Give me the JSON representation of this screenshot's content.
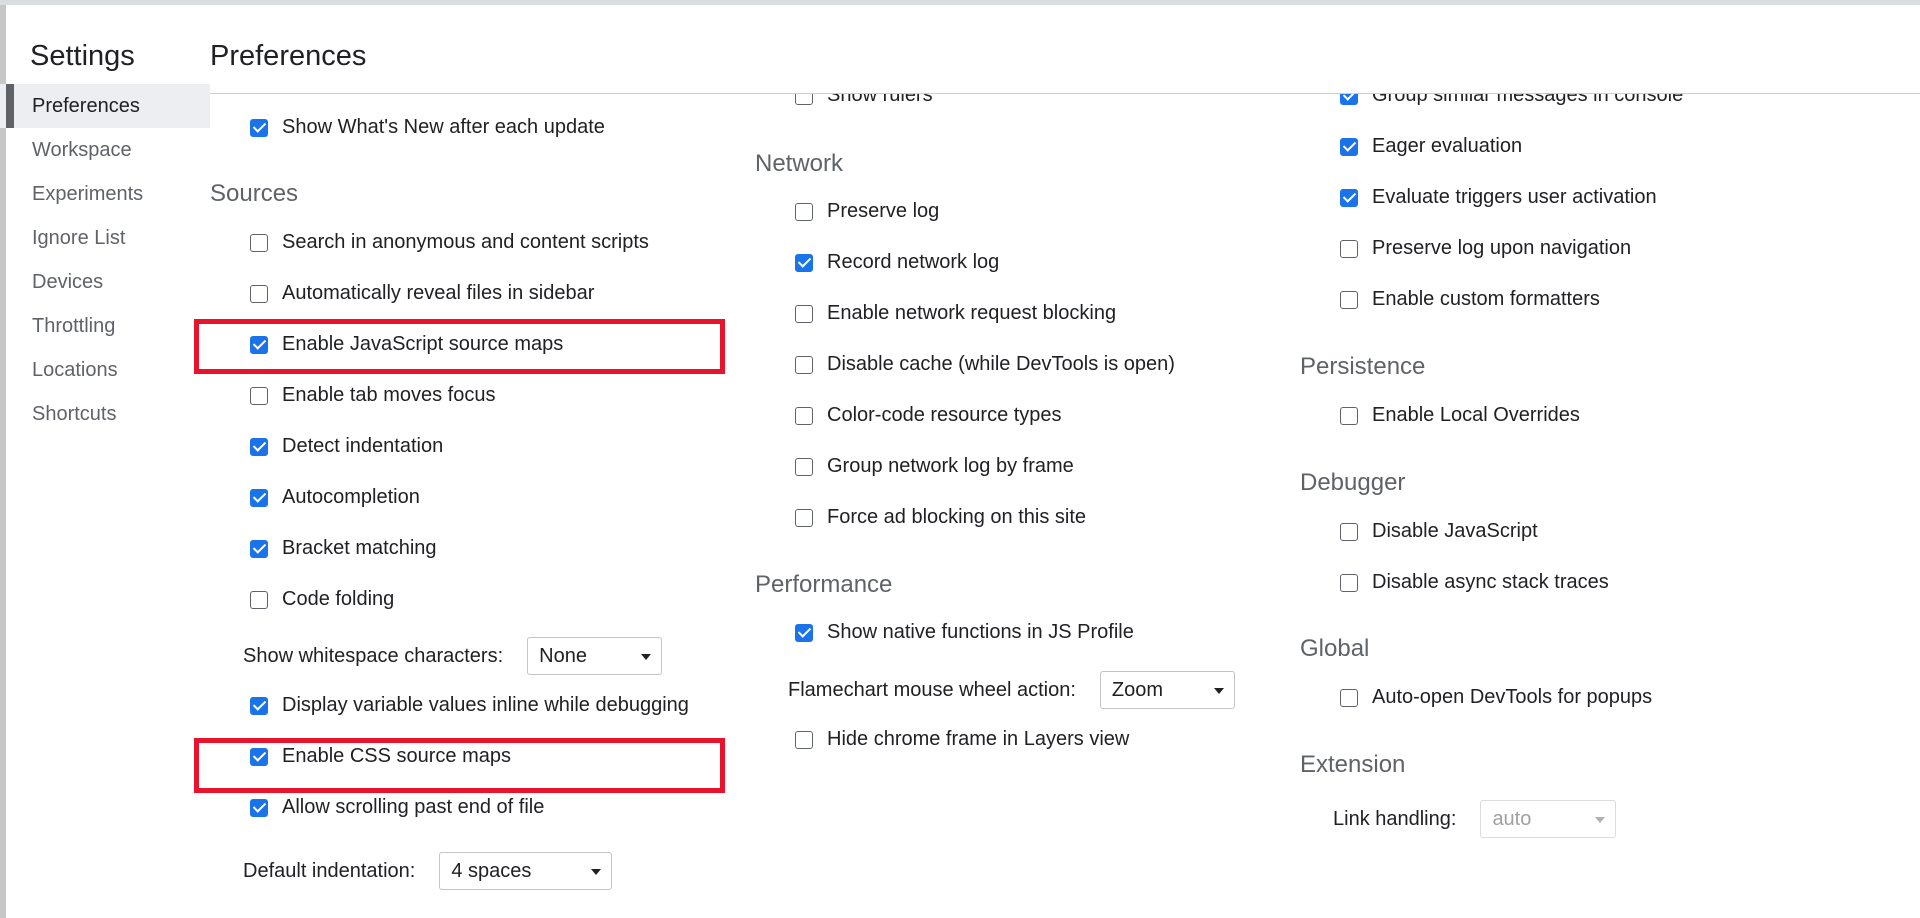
{
  "sidebar": {
    "title": "Settings",
    "items": [
      {
        "label": "Preferences",
        "active": true
      },
      {
        "label": "Workspace"
      },
      {
        "label": "Experiments"
      },
      {
        "label": "Ignore List"
      },
      {
        "label": "Devices"
      },
      {
        "label": "Throttling"
      },
      {
        "label": "Locations"
      },
      {
        "label": "Shortcuts"
      }
    ]
  },
  "page": {
    "title": "Preferences"
  },
  "col1": {
    "whats_new": {
      "label": "Show What's New after each update",
      "checked": true
    },
    "sources": {
      "heading": "Sources",
      "search_anonymous": {
        "label": "Search in anonymous and content scripts",
        "checked": false
      },
      "auto_reveal": {
        "label": "Automatically reveal files in sidebar",
        "checked": false
      },
      "js_source_maps": {
        "label": "Enable JavaScript source maps",
        "checked": true
      },
      "tab_moves_focus": {
        "label": "Enable tab moves focus",
        "checked": false
      },
      "detect_indentation": {
        "label": "Detect indentation",
        "checked": true
      },
      "autocompletion": {
        "label": "Autocompletion",
        "checked": true
      },
      "bracket_matching": {
        "label": "Bracket matching",
        "checked": true
      },
      "code_folding": {
        "label": "Code folding",
        "checked": false
      },
      "whitespace": {
        "label": "Show whitespace characters:",
        "value": "None"
      },
      "inline_values": {
        "label": "Display variable values inline while debugging",
        "checked": true
      },
      "css_source_maps": {
        "label": "Enable CSS source maps",
        "checked": true
      },
      "scroll_past_end": {
        "label": "Allow scrolling past end of file",
        "checked": true
      },
      "default_indentation": {
        "label": "Default indentation:",
        "value": "4 spaces"
      }
    }
  },
  "col2": {
    "show_rulers": {
      "label": "Show rulers",
      "checked": false
    },
    "network": {
      "heading": "Network",
      "preserve_log": {
        "label": "Preserve log",
        "checked": false
      },
      "record_log": {
        "label": "Record network log",
        "checked": true
      },
      "request_blocking": {
        "label": "Enable network request blocking",
        "checked": false
      },
      "disable_cache": {
        "label": "Disable cache (while DevTools is open)",
        "checked": false
      },
      "color_code": {
        "label": "Color-code resource types",
        "checked": false
      },
      "group_by_frame": {
        "label": "Group network log by frame",
        "checked": false
      },
      "force_ad_blocking": {
        "label": "Force ad blocking on this site",
        "checked": false
      }
    },
    "performance": {
      "heading": "Performance",
      "native_functions": {
        "label": "Show native functions in JS Profile",
        "checked": true
      },
      "flamechart": {
        "label": "Flamechart mouse wheel action:",
        "value": "Zoom"
      },
      "hide_chrome_frame": {
        "label": "Hide chrome frame in Layers view",
        "checked": false
      }
    }
  },
  "col3": {
    "group_similar": {
      "label": "Group similar messages in console",
      "checked": true
    },
    "eager_eval": {
      "label": "Eager evaluation",
      "checked": true
    },
    "user_activation": {
      "label": "Evaluate triggers user activation",
      "checked": true
    },
    "preserve_nav": {
      "label": "Preserve log upon navigation",
      "checked": false
    },
    "custom_formatters": {
      "label": "Enable custom formatters",
      "checked": false
    },
    "persistence": {
      "heading": "Persistence",
      "local_overrides": {
        "label": "Enable Local Overrides",
        "checked": false
      }
    },
    "debugger": {
      "heading": "Debugger",
      "disable_js": {
        "label": "Disable JavaScript",
        "checked": false
      },
      "disable_async": {
        "label": "Disable async stack traces",
        "checked": false
      }
    },
    "global": {
      "heading": "Global",
      "auto_open": {
        "label": "Auto-open DevTools for popups",
        "checked": false
      }
    },
    "extension": {
      "heading": "Extension",
      "link_handling": {
        "label": "Link handling:",
        "value": "auto"
      }
    }
  },
  "colors": {
    "accent": "#1a73e8",
    "highlight": "#e8132c"
  }
}
